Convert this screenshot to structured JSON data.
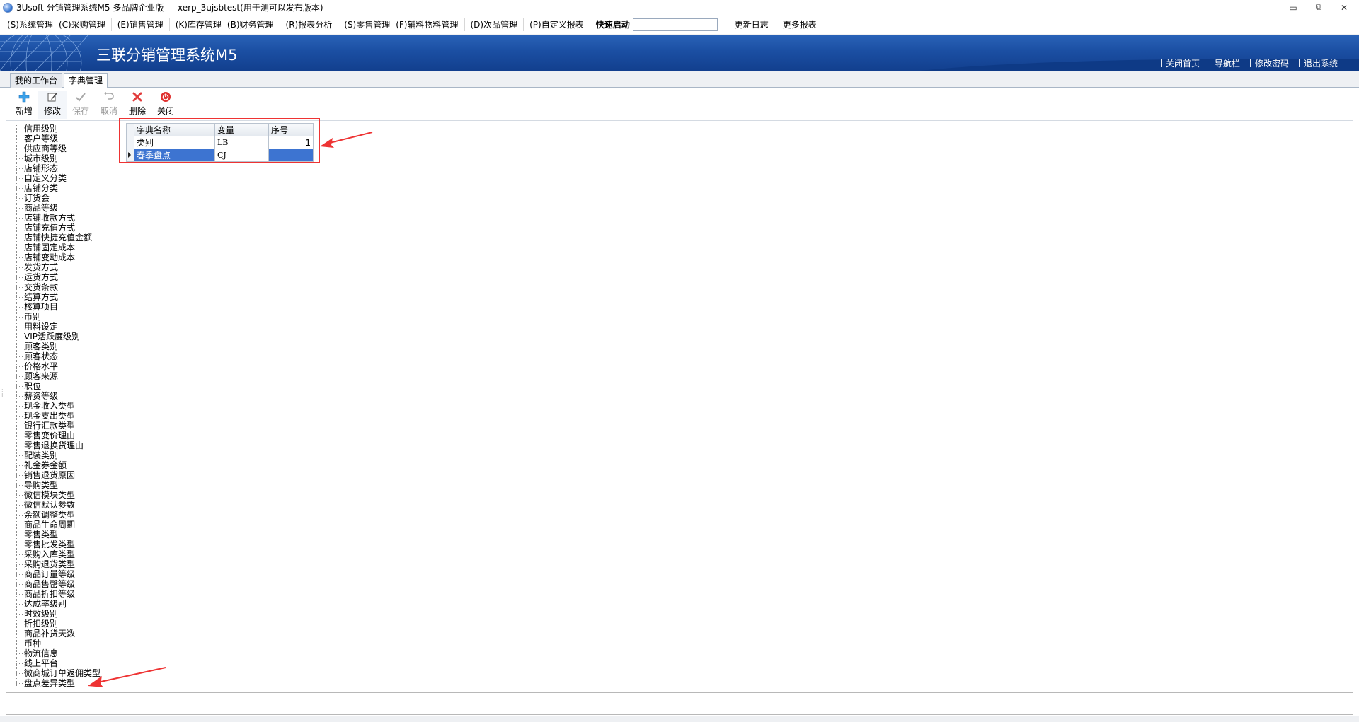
{
  "window": {
    "title": "3Usoft 分销管理系统M5 多品牌企业版 — xerp_3ujsbtest(用于测可以发布版本)",
    "controls": [
      "▭",
      "⧉",
      "✕"
    ]
  },
  "menu": {
    "items": [
      "(S)系统管理",
      "(C)采购管理",
      "(E)销售管理",
      "(K)库存管理",
      "(B)财务管理",
      "(R)报表分析",
      "(S)零售管理",
      "(F)辅料物料管理",
      "(D)次品管理",
      "(P)自定义报表"
    ],
    "quick_label": "快速启动",
    "quick_value": "",
    "extra": [
      "更新日志",
      "更多报表"
    ]
  },
  "banner": {
    "title": "三联分销管理系统M5",
    "links": [
      "关闭首页",
      "导航栏",
      "修改密码",
      "退出系统"
    ]
  },
  "tabs": [
    "我的工作台",
    "字典管理"
  ],
  "toolbar": {
    "buttons": [
      {
        "label": "新增",
        "icon": "plus-icon",
        "enabled": true
      },
      {
        "label": "修改",
        "icon": "edit-icon",
        "enabled": true
      },
      {
        "label": "保存",
        "icon": "check-icon",
        "enabled": false
      },
      {
        "label": "取消",
        "icon": "undo-icon",
        "enabled": false
      },
      {
        "label": "删除",
        "icon": "delete-x-icon",
        "enabled": true
      },
      {
        "label": "关闭",
        "icon": "power-icon",
        "enabled": true
      }
    ]
  },
  "tree": {
    "items": [
      "信用级别",
      "客户等级",
      "供应商等级",
      "城市级别",
      "店铺形态",
      "自定义分类",
      "店铺分类",
      "订货会",
      "商品等级",
      "店铺收款方式",
      "店铺充值方式",
      "店铺快捷充值金额",
      "店铺固定成本",
      "店铺变动成本",
      "发货方式",
      "运货方式",
      "交货条款",
      "结算方式",
      "核算项目",
      "币别",
      "用料设定",
      "VIP活跃度级别",
      "顾客类别",
      "顾客状态",
      "价格水平",
      "顾客来源",
      "职位",
      "薪资等级",
      "现金收入类型",
      "现金支出类型",
      "银行汇款类型",
      "零售变价理由",
      "零售退换货理由",
      "配装类别",
      "礼金券金额",
      "销售退货原因",
      "导购类型",
      "微信模块类型",
      "微信默认参数",
      "余额调整类型",
      "商品生命周期",
      "零售类型",
      "零售批发类型",
      "采购入库类型",
      "采购退货类型",
      "商品订量等级",
      "商品售罄等级",
      "商品折扣等级",
      "达成率级别",
      "时效级别",
      "折扣级别",
      "商品补货天数",
      "币种",
      "物流信息",
      "线上平台",
      "微商城订单返佣类型",
      "盘点差异类型"
    ],
    "selected": "盘点差异类型"
  },
  "grid": {
    "columns": [
      "字典名称",
      "变量",
      "序号"
    ],
    "rows": [
      {
        "name": "类别",
        "var": "LB",
        "seq": "1"
      },
      {
        "name": "春季盘点",
        "var": "CJ",
        "seq": ""
      }
    ],
    "selected_row": 1
  },
  "colors": {
    "banner": "#1b4fa3",
    "highlight": "#ee3333",
    "selection": "#3d74d1"
  }
}
